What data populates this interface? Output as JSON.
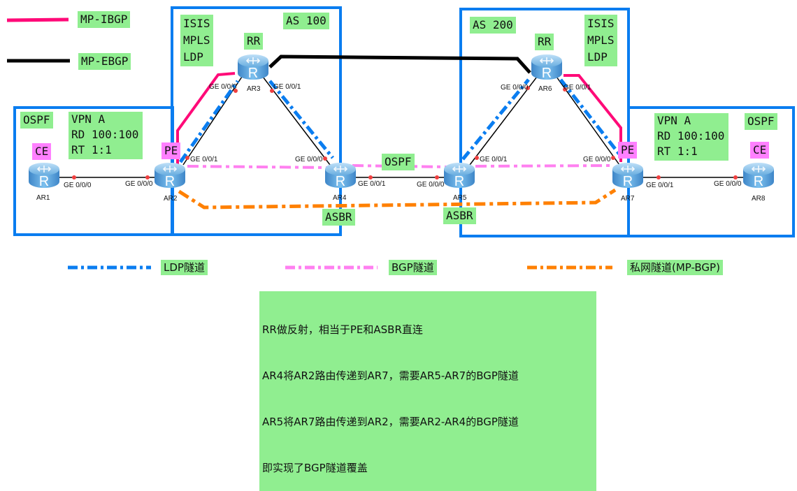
{
  "legend_top": {
    "mp_ibgp": {
      "label": "MP-IBGP",
      "color": "#ff0a78"
    },
    "mp_ebgp": {
      "label": "MP-EBGP",
      "color": "#000000"
    }
  },
  "legend_bottom": {
    "ldp_tunnel": {
      "label": "LDP隧道",
      "color": "#0a7df0"
    },
    "bgp_tunnel": {
      "label": "BGP隧道",
      "color": "#ff80f0"
    },
    "private_tunnel": {
      "label": "私网隧道(MP-BGP)",
      "color": "#ff8000"
    }
  },
  "as100": {
    "as_label": "AS 100",
    "protocols": "ISIS\nMPLS\nLDP"
  },
  "as200": {
    "as_label": "AS 200",
    "protocols": "ISIS\nMPLS\nLDP"
  },
  "left_site": {
    "protocol": "OSPF",
    "vpn": "VPN A\nRD 100:100\nRT 1:1"
  },
  "right_site": {
    "protocol": "OSPF",
    "vpn": "VPN A\nRD 100:100\nRT 1:1"
  },
  "link_ospf_label": "OSPF",
  "routers": {
    "ar1": {
      "name": "AR1",
      "role": "CE"
    },
    "ar2": {
      "name": "AR2",
      "role": "PE"
    },
    "ar3": {
      "name": "AR3",
      "role": "RR"
    },
    "ar4": {
      "name": "AR4",
      "role": "ASBR"
    },
    "ar5": {
      "name": "AR5",
      "role": "ASBR"
    },
    "ar6": {
      "name": "AR6",
      "role": "RR"
    },
    "ar7": {
      "name": "AR7",
      "role": "PE"
    },
    "ar8": {
      "name": "AR8",
      "role": "CE"
    }
  },
  "interfaces": {
    "ar1_g000": "GE 0/0/0",
    "ar2_g000": "GE 0/0/0",
    "ar2_g001": "GE 0/0/1",
    "ar3_g000": "GE 0/0/0",
    "ar3_g001": "GE 0/0/1",
    "ar4_g000": "GE 0/0/0",
    "ar4_g001": "GE 0/0/1",
    "ar5_g000": "GE 0/0/0",
    "ar5_g001": "GE 0/0/1",
    "ar6_g000": "GE 0/0/0",
    "ar6_g001": "GE 0/0/1",
    "ar7_g000": "GE 0/0/0",
    "ar7_g001": "GE 0/0/1",
    "ar8_g000": "GE 0/0/0"
  },
  "note": {
    "lines": [
      "RR做反射，相当于PE和ASBR直连",
      "AR4将AR2路由传递到AR7，需要AR5-AR7的BGP隧道",
      "AR5将AR7路由传递到AR2，需要AR2-AR4的BGP隧道",
      "即实现了BGP隧道覆盖"
    ]
  },
  "colors": {
    "box_border": "#0a7df0",
    "label_bg": "#90ee90",
    "role_bg": "#ff80ff",
    "link": "#000000",
    "port_dot": "#f04040"
  }
}
